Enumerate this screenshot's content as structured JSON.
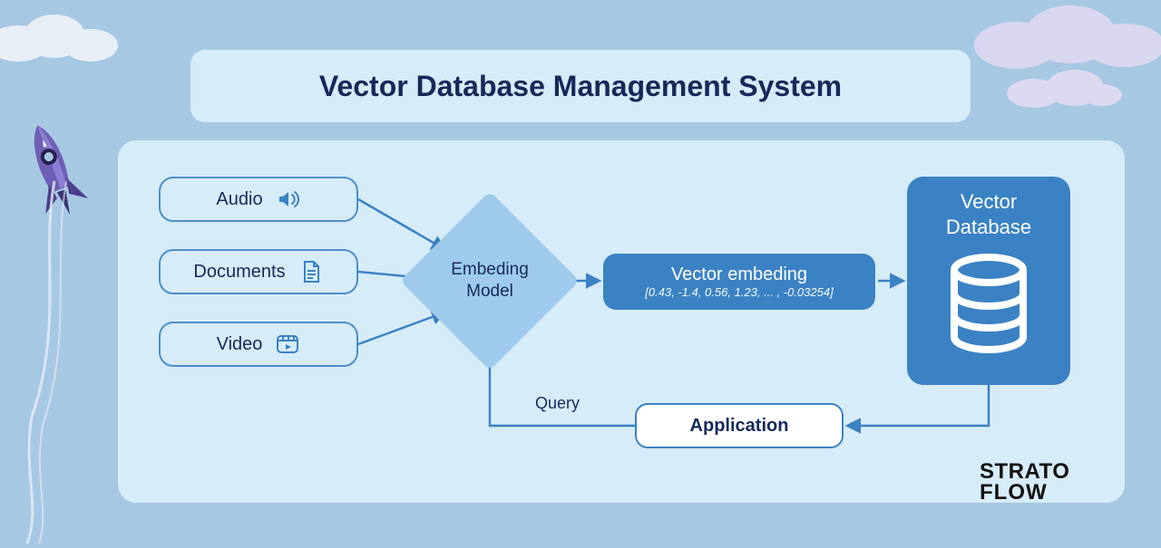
{
  "title": "Vector Database Management System",
  "inputs": {
    "audio": "Audio",
    "documents": "Documents",
    "video": "Video"
  },
  "embedding_model": {
    "line1": "Embeding",
    "line2": "Model"
  },
  "vector_embedding": {
    "title": "Vector embeding",
    "values": "[0.43, -1.4, 0.56, 1.23, ... , -0.03254]"
  },
  "vector_database": {
    "line1": "Vector",
    "line2": "Database"
  },
  "application": "Application",
  "query_label": "Query",
  "brand": {
    "line1": "STRATO",
    "line2": "FLOW"
  },
  "colors": {
    "bg": "#a7c8e3",
    "panel": "#d7ecf9",
    "outline_light": "#4d8fc8",
    "fill_mid": "#9ecbeb",
    "fill_dark": "#3b82c4",
    "text_dark": "#15295a"
  }
}
